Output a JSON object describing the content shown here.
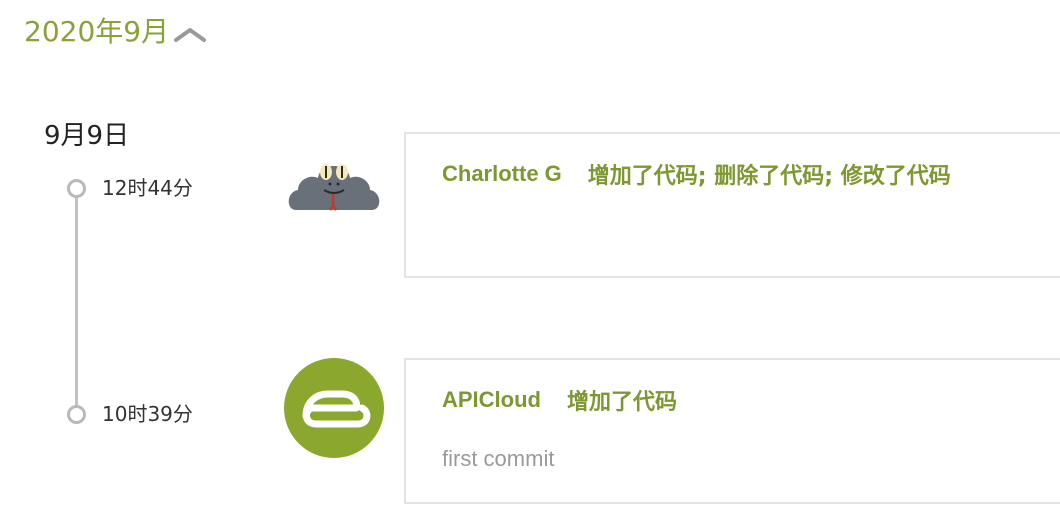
{
  "timeline": {
    "month_label": "2020年9月",
    "collapse_icon": "chevron-up-icon",
    "day_label": "9月9日",
    "accent_color": "#7d9731",
    "entries": [
      {
        "time": "12时44分",
        "author": "Charlotte G",
        "action": "增加了代码; 删除了代码; 修改了代码",
        "message": "",
        "avatar_icon": "snake-cloud-avatar"
      },
      {
        "time": "10时39分",
        "author": "APICloud",
        "action": "增加了代码",
        "message": "first commit",
        "avatar_icon": "apicloud-logo-avatar"
      }
    ]
  }
}
